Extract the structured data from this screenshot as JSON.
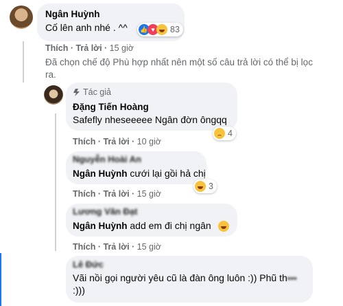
{
  "comments": [
    {
      "author": "Ngân Huỳnh",
      "text": "Cố lên anh nhé . ^^",
      "reaction_count": "83",
      "actions": {
        "like": "Thích",
        "reply": "Trả lời",
        "time": "15 giờ"
      }
    },
    {
      "notice": "Đã chọn chế độ Phù hợp nhất nên một số câu trả lời có thể bị lọc ra."
    }
  ],
  "replies": [
    {
      "badge": "Tác giả",
      "author": "Đặng Tiến Hoàng",
      "text": "Safefly nheseeeee Ngân đờn ôngqq",
      "reaction_count": "4",
      "actions": {
        "like": "Thích",
        "reply": "Trả lời",
        "time": "10 giờ"
      }
    },
    {
      "author_blurred": "Nguyễn Hoài An",
      "mention": "Ngân Huỳnh",
      "text": " cưới lại gồi hả chị",
      "reaction_count": "3",
      "actions": {
        "like": "Thích",
        "reply": "Trả lời",
        "time": "15 giờ"
      }
    },
    {
      "author_blurred": "Lương Văn Đạt",
      "mention": "Ngân Huỳnh",
      "text": " add em đi chị ngân",
      "actions": {
        "like": "Thích",
        "reply": "Trả lời",
        "time": "15 giờ"
      }
    },
    {
      "author_blurred": "Lê Đức",
      "text": "Vãi nồi gọi người yêu cũ là đàn ông luôn :)) Phũ th",
      "text2": ":)))"
    }
  ],
  "colors": {
    "bubble": "#f0f2f5",
    "meta": "#65676b",
    "accent": "#1877f2"
  },
  "icons": [
    "like-reaction-icon",
    "love-reaction-icon",
    "haha-reaction-icon",
    "sad-reaction-icon",
    "wow-reaction-icon",
    "author-badge-icon"
  ]
}
